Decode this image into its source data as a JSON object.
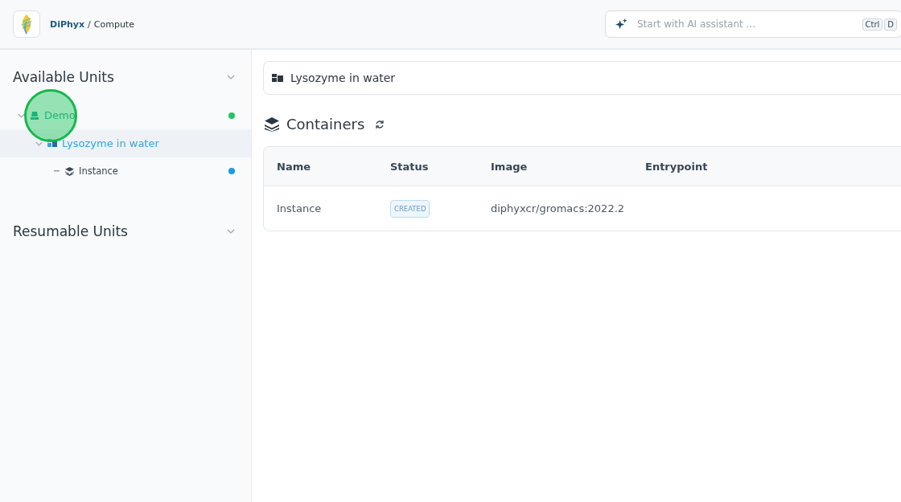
{
  "breadcrumb": {
    "brand": "DiPhyx",
    "separator": "/",
    "page": "Compute"
  },
  "assistant": {
    "placeholder": "Start with AI assistant ...",
    "keys": [
      "Ctrl",
      "D"
    ]
  },
  "sidebar": {
    "sections": [
      {
        "title": "Available Units",
        "expanded": true,
        "items": [
          {
            "label": "Demo",
            "kind": "unit",
            "expanded": true,
            "selected": false,
            "color": "#22c55e",
            "children": [
              {
                "label": "Lysozyme in water",
                "kind": "project",
                "expanded": true,
                "selected": true,
                "children": [
                  {
                    "label": "Instance",
                    "kind": "instance",
                    "selected": false,
                    "color": "#1e9be0"
                  }
                ]
              }
            ]
          }
        ]
      },
      {
        "title": "Resumable Units",
        "expanded": true
      }
    ]
  },
  "main": {
    "project_title": "Lysozyme in water",
    "section_title": "Containers",
    "table": {
      "columns": [
        "Name",
        "Status",
        "Image",
        "Entrypoint"
      ],
      "rows": [
        {
          "name": "Instance",
          "status": "CREATED",
          "image": "diphyxcr/gromacs:2022.2"
        }
      ]
    }
  }
}
